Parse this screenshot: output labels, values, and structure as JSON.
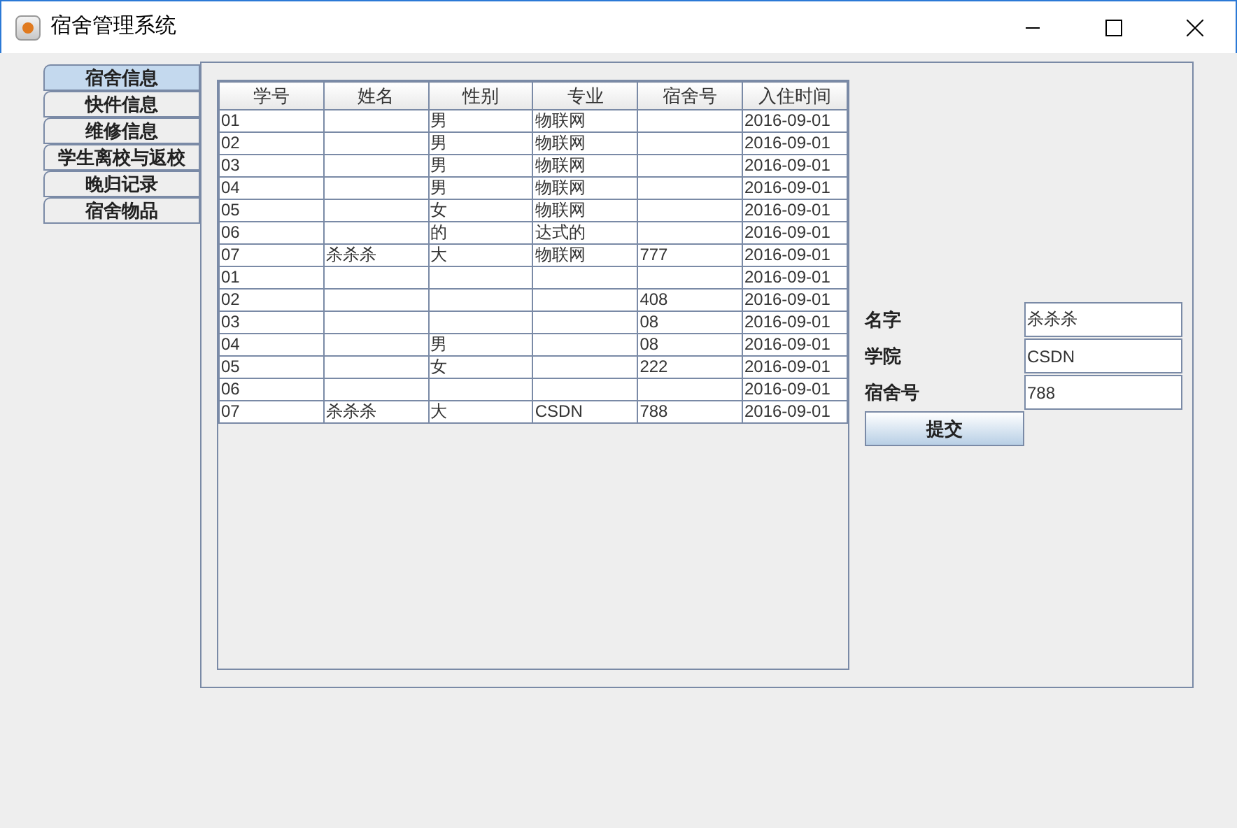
{
  "window": {
    "title": "宿舍管理系统"
  },
  "tabs": [
    {
      "label": "宿舍信息",
      "selected": true
    },
    {
      "label": "快件信息",
      "selected": false
    },
    {
      "label": "维修信息",
      "selected": false
    },
    {
      "label": "学生离校与返校",
      "selected": false
    },
    {
      "label": "晚归记录",
      "selected": false
    },
    {
      "label": "宿舍物品",
      "selected": false
    }
  ],
  "table": {
    "columns": [
      "学号",
      "姓名",
      "性别",
      "专业",
      "宿舍号",
      "入住时间"
    ],
    "rows": [
      {
        "id": "01",
        "gender": "男",
        "major": "物联网",
        "date": "2016-09-01"
      },
      {
        "id": "02",
        "gender": "男",
        "major": "物联网",
        "date": "2016-09-01"
      },
      {
        "id": "03",
        "gender": "男",
        "major": "物联网",
        "date": "2016-09-01"
      },
      {
        "id": "04",
        "gender": "男",
        "major": "物联网",
        "date": "2016-09-01"
      },
      {
        "id": "05",
        "gender": "女",
        "major": "物联网",
        "date": "2016-09-01"
      },
      {
        "id": "06",
        "gender": "的",
        "major": "达式的",
        "date": "2016-09-01"
      },
      {
        "id": "07",
        "name": "杀杀杀",
        "gender": "大",
        "major": "物联网",
        "room": "777",
        "date": "2016-09-01"
      },
      {
        "id": "01",
        "date": "2016-09-01"
      },
      {
        "id": "02",
        "room": "408",
        "date": "2016-09-01"
      },
      {
        "id": "03",
        "room": "08",
        "date": "2016-09-01"
      },
      {
        "id": "04",
        "gender": "男",
        "room": "08",
        "date": "2016-09-01"
      },
      {
        "id": "05",
        "gender": "女",
        "room": "222",
        "date": "2016-09-01"
      },
      {
        "id": "06",
        "date": "2016-09-01"
      },
      {
        "id": "07",
        "name": "杀杀杀",
        "gender": "大",
        "major": "CSDN",
        "room": "788",
        "date": "2016-09-01"
      }
    ]
  },
  "form": {
    "fields": [
      {
        "label": "名字",
        "value": "杀杀杀"
      },
      {
        "label": "学院",
        "value": "CSDN"
      },
      {
        "label": "宿舍号",
        "value": "788"
      }
    ],
    "submit": "提交"
  }
}
